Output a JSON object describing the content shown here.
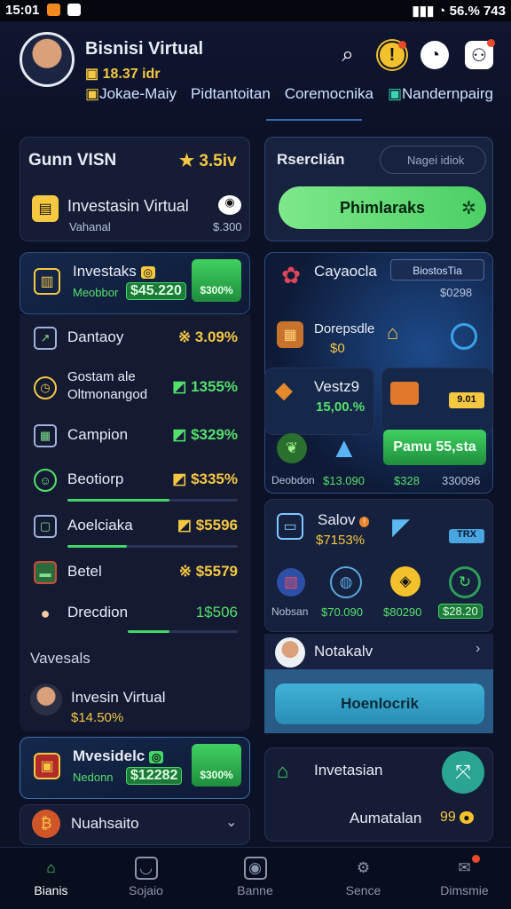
{
  "status": {
    "time": "15:01",
    "right": "56.% 743"
  },
  "profile": {
    "name": "Bisnisi Virtual",
    "balance": "18.37 idr"
  },
  "nav": {
    "links": [
      "Jokae-Maiy",
      "Pidtantoitan",
      "Coremocnika",
      "Nandernpairg"
    ]
  },
  "left_top": {
    "title": "Gunn VISN",
    "value": "3.5iv",
    "item_title": "Investasin Virtual",
    "item_sub": "Vahanal",
    "item_value": "$.300"
  },
  "invest_card": {
    "title": "Investaks",
    "sub": "Meobbor",
    "amount": "$45.220",
    "button": "$300%"
  },
  "rows": [
    {
      "label": "Dantaoy",
      "value": "3.09%",
      "mark": "※"
    },
    {
      "label": "Gostam ale",
      "label2": "Oltmonangod",
      "value": "1355%",
      "mark": "◩"
    },
    {
      "label": "Campion",
      "value": "$329%",
      "mark": "◩"
    },
    {
      "label": "Beotiorp",
      "value": "$335%",
      "mark": "◩"
    },
    {
      "label": "Aoelciaka",
      "value": "$5596",
      "mark": "◩"
    },
    {
      "label": "Betel",
      "value": "$5579",
      "mark": "※"
    },
    {
      "label": "Drecdion",
      "value": "1$506",
      "mark": ""
    }
  ],
  "section_label": "Vavesals",
  "virtual_item": {
    "title": "Invesin Virtual",
    "value": "$14.50%"
  },
  "bottom_left": {
    "title": "Mvesidelc",
    "sub": "Nedonn",
    "amount": "$12282",
    "button": "$300%"
  },
  "collapse_item": {
    "label": "Nuahsaito"
  },
  "right_top": {
    "title": "Rserclián",
    "search_placeholder": "Nagei idiok",
    "button": "Phimlaraks"
  },
  "right_mid": {
    "title": "Cayaocla",
    "tag1": "BiostosTia",
    "tag2": "$0298",
    "tile1_title": "Dorepsdle",
    "tile1_sub": "$0"
  },
  "tiles": {
    "vest": {
      "title": "Vestz9",
      "value": "15,00.%",
      "badge": "9.01"
    },
    "cta": "Pamu 55,sta",
    "row_labels": [
      "Deobdon",
      "$13.090",
      "$328",
      "330096"
    ]
  },
  "sales": {
    "title": "Salov",
    "value": "$7153%",
    "badge": "TRX"
  },
  "coins_row": [
    "Nobsan",
    "$70.090",
    "$80290",
    "$28.20"
  ],
  "notakaiv": {
    "title": "Notakalv"
  },
  "big_button": "Hoenlocrik",
  "invest_bottom": {
    "title": "Invetasian",
    "sub": "Aumatalan",
    "value": "99"
  },
  "tabs": [
    {
      "label": "Bianis",
      "icon": "home-icon"
    },
    {
      "label": "Sojaio",
      "icon": "wallet-icon"
    },
    {
      "label": "Banne",
      "icon": "camera-icon"
    },
    {
      "label": "Sence",
      "icon": "gear-icon"
    },
    {
      "label": "Dimsmie",
      "icon": "chat-icon"
    }
  ],
  "colors": {
    "accent": "#43d768",
    "gold": "#f5c842",
    "bg": "#0c1226"
  }
}
